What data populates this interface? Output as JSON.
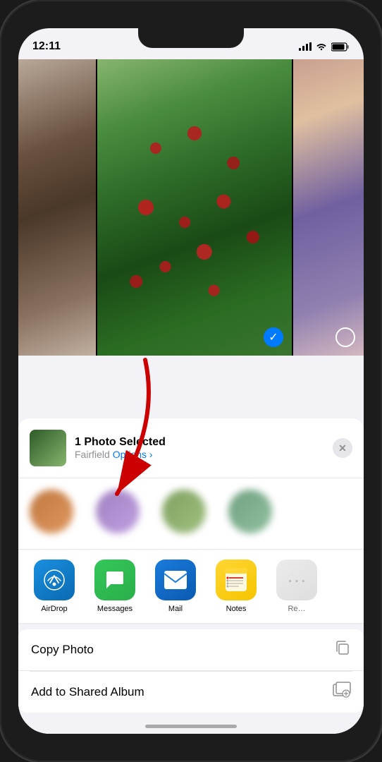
{
  "phone": {
    "status_bar": {
      "time": "12:11",
      "location_icon": "▶",
      "signal": "●●●",
      "wifi": "WiFi",
      "battery": "Battery"
    }
  },
  "share_sheet": {
    "header": {
      "title": "1 Photo Selected",
      "subtitle": "Fairfield",
      "options_label": "Options ›",
      "close_label": "×"
    },
    "contacts": [
      {
        "name": "",
        "blurred": true
      },
      {
        "name": "",
        "blurred": true
      },
      {
        "name": "",
        "blurred": true
      },
      {
        "name": "",
        "blurred": true
      }
    ],
    "apps": [
      {
        "name": "AirDrop",
        "icon_type": "airdrop"
      },
      {
        "name": "Messages",
        "icon_type": "messages"
      },
      {
        "name": "Mail",
        "icon_type": "mail"
      },
      {
        "name": "Notes",
        "icon_type": "notes"
      },
      {
        "name": "Re…",
        "icon_type": "more"
      }
    ],
    "actions": [
      {
        "label": "Copy Photo",
        "icon": "copy"
      },
      {
        "label": "Add to Shared Album",
        "icon": "album"
      }
    ]
  }
}
